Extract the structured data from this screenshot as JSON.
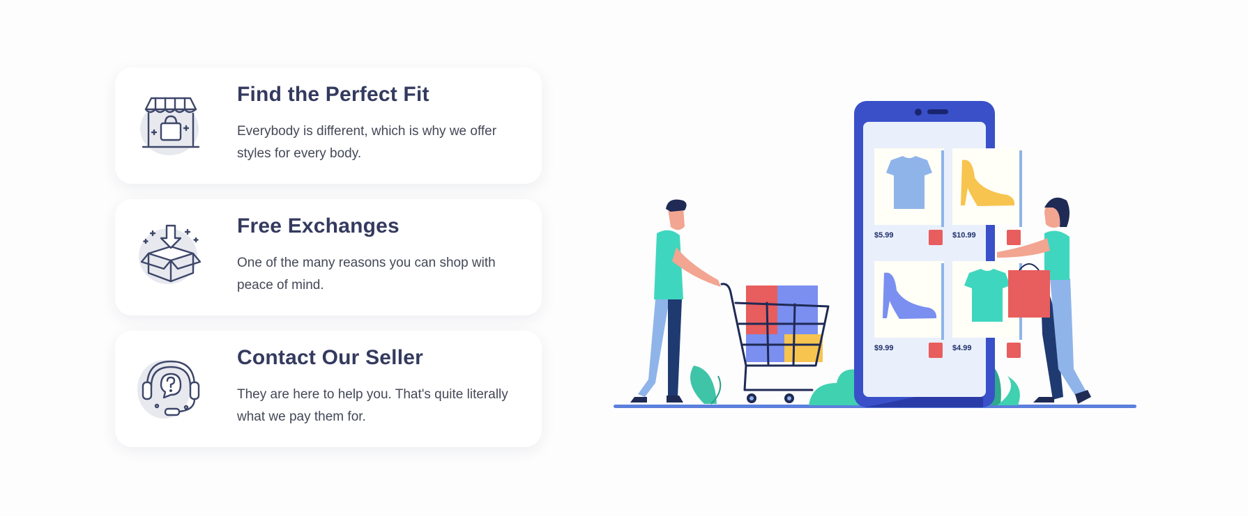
{
  "features": [
    {
      "title": "Find the Perfect Fit",
      "description": "Everybody is different, which is why we offer styles for every body.",
      "icon": "storefront-icon"
    },
    {
      "title": "Free Exchanges",
      "description": "One of the many reasons you can shop with peace of mind.",
      "icon": "box-exchange-icon"
    },
    {
      "title": "Contact Our Seller",
      "description": "They are here to help you. That's quite literally what we pay them for.",
      "icon": "support-headset-icon"
    }
  ],
  "illustration": {
    "products": [
      {
        "item": "tshirt-blue",
        "price": "$5.99"
      },
      {
        "item": "heel-yellow",
        "price": "$10.99"
      },
      {
        "item": "heel-blue",
        "price": "$9.99"
      },
      {
        "item": "tshirt-teal",
        "price": "$4.99"
      }
    ]
  },
  "colors": {
    "heading": "#343a5e",
    "text": "#444857",
    "phone": "#3a50c9",
    "teal": "#3fd6bf",
    "red": "#e85d5d"
  }
}
